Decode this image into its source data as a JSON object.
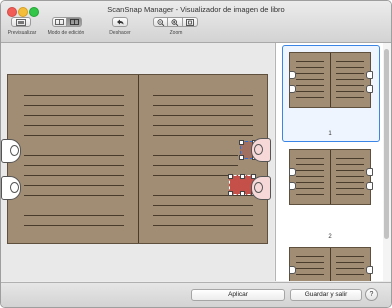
{
  "window": {
    "title": "ScanSnap Manager - Visualizador de imagen de libro"
  },
  "toolbar": {
    "preview_label": "Previsualizar",
    "edit_mode_label": "Modo de edición",
    "undo_label": "Deshacer",
    "zoom_label": "Zoom",
    "icons": {
      "preview": "preview-window-icon",
      "edit_single": "book-open-icon",
      "edit_active": "edit-mode-icon",
      "undo": "undo-arrow-icon",
      "zoom_out": "zoom-out-icon",
      "zoom_in": "zoom-in-icon",
      "fit": "fit-window-icon"
    }
  },
  "thumbnails": [
    {
      "number": "1",
      "selected": true
    },
    {
      "number": "2",
      "selected": false
    },
    {
      "number": "",
      "selected": false
    }
  ],
  "buttons": {
    "apply": "Aplicar",
    "save_exit": "Guardar y salir",
    "help": "?"
  },
  "colors": {
    "book": "#a18c74",
    "selection_blue": "#3a85e6",
    "finger_selection_red": "#d23c3c"
  }
}
